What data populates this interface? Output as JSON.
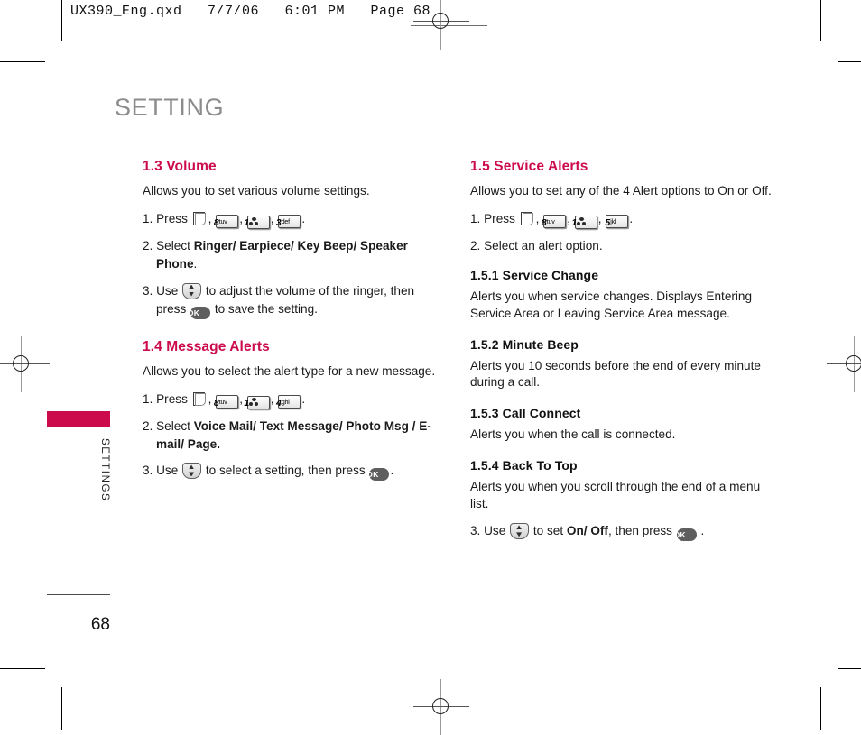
{
  "print_header": {
    "text": "UX390_Eng.qxd   7/7/06   6:01 PM   Page 68"
  },
  "page": {
    "title": "SETTING",
    "side_label": "SETTINGS",
    "number": "68",
    "accent_color": "#cc0b4c",
    "title_color": "#8c8c8c"
  },
  "keys": {
    "softkey_label": "menu-softkey",
    "k8": {
      "num": "8",
      "sub": "tuv"
    },
    "k1": {
      "num": "1",
      "sub": "voicemail"
    },
    "k3": {
      "num": "3",
      "sub": "def"
    },
    "k4": {
      "num": "4",
      "sub": "ghi"
    },
    "k5": {
      "num": "5",
      "sub": "jkl"
    },
    "ok_label": "OK"
  },
  "left_column": {
    "section_1_3": {
      "heading": "1.3 Volume",
      "intro": "Allows you to set various volume settings.",
      "step1_prefix": "1. Press",
      "step1_sep1": ",",
      "step1_sep2": ",",
      "step1_sep3": ",",
      "step1_end": ".",
      "step2_prefix": "2. Select",
      "step2_bold": "Ringer/ Earpiece/ Key Beep/ Speaker Phone",
      "step2_end": ".",
      "step3_prefix": "3. Use",
      "step3_mid": "to adjust the volume of the ringer, then press",
      "step3_end": "to save the setting."
    },
    "section_1_4": {
      "heading": "1.4 Message Alerts",
      "intro": "Allows you to select the alert type for a new message.",
      "step1_prefix": "1. Press",
      "step1_sep1": ",",
      "step1_sep2": ",",
      "step1_sep3": ",",
      "step1_end": ".",
      "step2_prefix": "2. Select",
      "step2_bold": "Voice Mail/ Text Message/ Photo Msg / E-mail/ Page.",
      "step3_prefix": "3. Use",
      "step3_mid": "to select a setting, then press",
      "step3_end": "."
    }
  },
  "right_column": {
    "section_1_5": {
      "heading": "1.5 Service Alerts",
      "intro": "Allows you to set any of the 4 Alert options to On or Off.",
      "step1_prefix": "1. Press",
      "step1_sep1": ",",
      "step1_sep2": ",",
      "step1_sep3": ",",
      "step1_end": ".",
      "step2": "2. Select an alert option."
    },
    "subsections": [
      {
        "heading": "1.5.1 Service Change",
        "body": "Alerts you when service changes. Displays Entering Service Area or Leaving Service Area message."
      },
      {
        "heading": "1.5.2 Minute Beep",
        "body": "Alerts you 10 seconds before the end of every minute during a call."
      },
      {
        "heading": "1.5.3 Call Connect",
        "body": "Alerts you when the call is connected."
      },
      {
        "heading": "1.5.4 Back To Top",
        "body": "Alerts you when you scroll through the end of a menu list."
      }
    ],
    "final_step": {
      "prefix": "3. Use",
      "mid": "to set",
      "bold": "On/ Off",
      "mid2": ", then press",
      "end": "."
    }
  }
}
